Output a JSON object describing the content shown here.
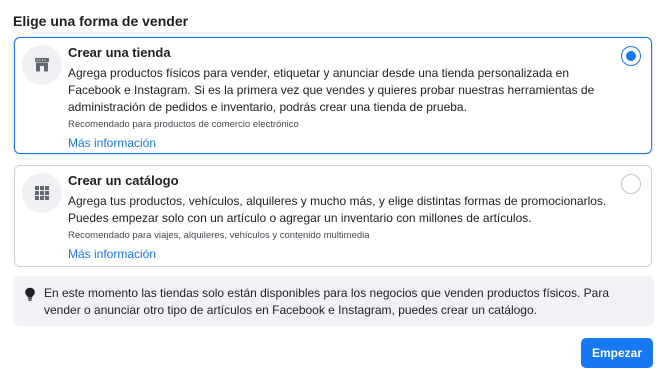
{
  "heading": "Elige una forma de vender",
  "options": [
    {
      "icon": "storefront-icon",
      "title": "Crear una tienda",
      "description": "Agrega productos físicos para vender, etiquetar y anunciar desde una tienda personalizada en Facebook e Instagram. Si es la primera vez que vendes y quieres probar nuestras herramientas de administración de pedidos e inventario, podrás crear una tienda de prueba.",
      "recommendation": "Recomendado para productos de comercio electrónico",
      "link": "Más información",
      "selected": true
    },
    {
      "icon": "grid-icon",
      "title": "Crear un catálogo",
      "description": "Agrega tus productos, vehículos, alquileres y mucho más, y elige distintas formas de promocionarlos. Puedes empezar solo con un artículo o agregar un inventario con millones de artículos.",
      "recommendation": "Recomendado para viajes, alquileres, vehículos y contenido multimedia",
      "link": "Más información",
      "selected": false
    }
  ],
  "info": {
    "icon": "lightbulb-icon",
    "text": "En este momento las tiendas solo están disponibles para los negocios que venden productos físicos. Para vender o anunciar otro tipo de artículos en Facebook e Instagram, puedes crear un catálogo."
  },
  "primary_button": "Empezar",
  "colors": {
    "accent": "#1877f2",
    "info_bg": "#f0f2f5",
    "icon_bg": "#eef0f3"
  }
}
